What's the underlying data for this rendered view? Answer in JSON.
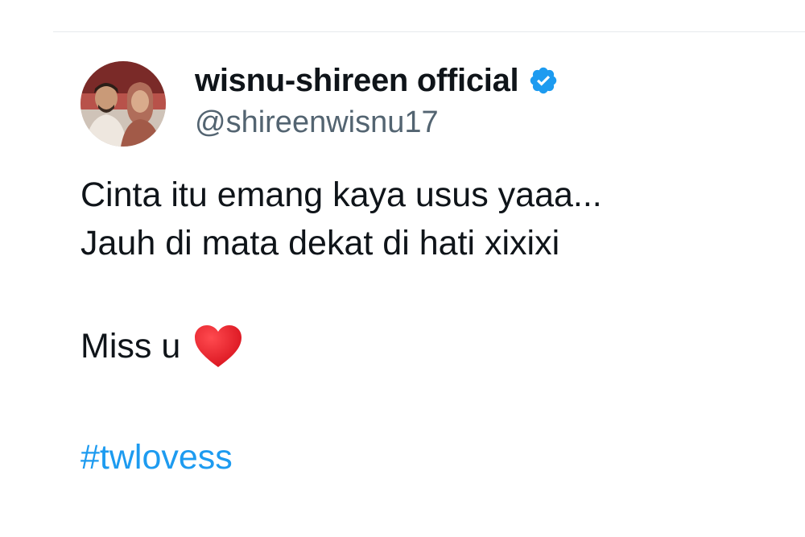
{
  "tweet": {
    "display_name": "wisnu-shireen official",
    "handle": "@shireenwisnu17",
    "verified": true,
    "avatar": "couple-profile-photo",
    "lines": [
      "Cinta itu emang kaya usus yaaa...",
      "Jauh di mata dekat di hati xixixi"
    ],
    "miss_text": "Miss u",
    "emoji": "red-heart-icon",
    "hashtag": "#twlovess"
  },
  "colors": {
    "text": "#0f1419",
    "secondary": "#536471",
    "link": "#1d9bf0",
    "verified_badge": "#1d9bf0",
    "heart": "#e0202b",
    "divider": "#e6e9ec"
  }
}
